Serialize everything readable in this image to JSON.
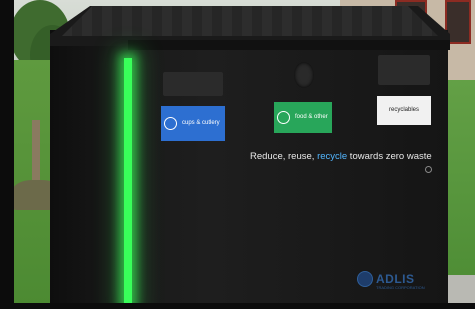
{
  "scene": {
    "bin_color": "#1a1a1a",
    "light_color": "#39ff5a",
    "labels": [
      {
        "text": "cups & cutlery",
        "color": "#2d6fd1"
      },
      {
        "text": "food & other",
        "color": "#28a65a"
      },
      {
        "text": "recyclables",
        "color": "#f1f1f1"
      }
    ],
    "tagline": {
      "part1": "Reduce, reuse, ",
      "highlight": "recycle",
      "part2": " towards zero waste",
      "highlight_color": "#52b6ff"
    },
    "brand": {
      "name": "ADLIS",
      "subtitle": "TRADING CORPORATION"
    }
  }
}
